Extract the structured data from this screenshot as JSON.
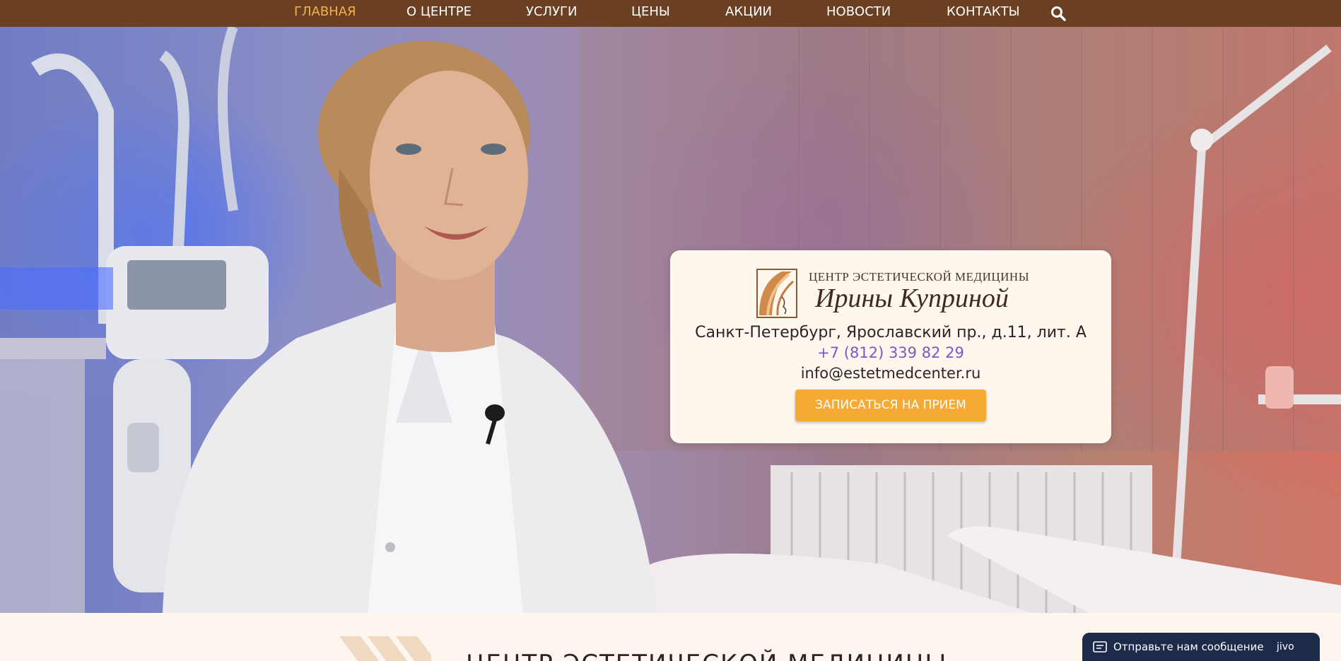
{
  "nav": {
    "items": [
      {
        "label": "ГЛАВНАЯ",
        "active": true
      },
      {
        "label": "О ЦЕНТРЕ",
        "active": false
      },
      {
        "label": "УСЛУГИ",
        "active": false
      },
      {
        "label": "ЦЕНЫ",
        "active": false
      },
      {
        "label": "АКЦИИ",
        "active": false
      },
      {
        "label": "НОВОСТИ",
        "active": false
      },
      {
        "label": "КОНТАКТЫ",
        "active": false
      }
    ],
    "search_icon": "search-icon"
  },
  "card": {
    "logo_top": "ЦЕНТР ЭСТЕТИЧЕСКОЙ МЕДИЦИНЫ",
    "logo_name": "Ирины Куприной",
    "address": "Санкт-Петербург, Ярославский пр., д.11, лит. А",
    "phone": "+7 (812) 339 82 29",
    "email": "info@estetmedcenter.ru",
    "cta": "ЗАПИСАТЬСЯ НА ПРИЕМ"
  },
  "section": {
    "title": "ЦЕНТР ЭСТЕТИЧЕСКОЙ МЕДИЦИНЫ"
  },
  "chat": {
    "text": "Отправьте нам сообщение",
    "brand": "jivo",
    "icon": "message-icon"
  },
  "colors": {
    "nav_bg": "#6b3f22",
    "nav_active": "#f2b14e",
    "cta_bg": "#f6a933",
    "phone": "#7a58c4",
    "chat_bg": "#1e2a4a"
  }
}
